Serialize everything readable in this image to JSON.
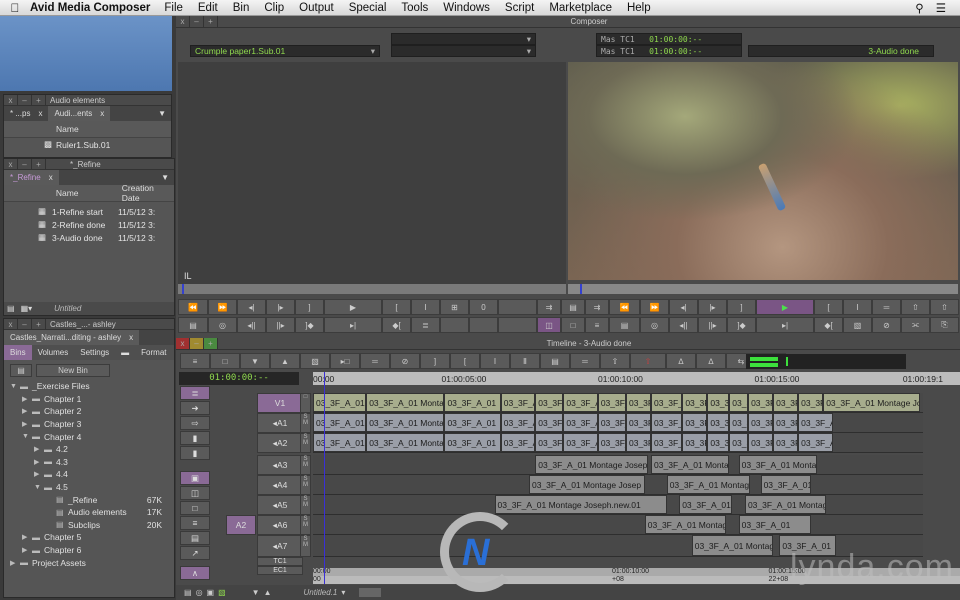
{
  "menubar": {
    "app": "Avid Media Composer",
    "items": [
      "File",
      "Edit",
      "Bin",
      "Clip",
      "Output",
      "Special",
      "Tools",
      "Windows",
      "Script",
      "Marketplace",
      "Help"
    ]
  },
  "audio_bin": {
    "title": "Audio elements",
    "tabs": [
      "* ...ps",
      "Audi...ents"
    ],
    "col_name": "Name",
    "rows": [
      "Ruler1.Sub.01"
    ]
  },
  "refine_bin": {
    "title": "*_Refine",
    "tab": "*_Refine",
    "col_name": "Name",
    "col_date": "Creation Date",
    "rows": [
      {
        "name": "1-Refine start",
        "date": "11/5/12 3:"
      },
      {
        "name": "2-Refine done",
        "date": "11/5/12 3:"
      },
      {
        "name": "3-Audio done",
        "date": "11/5/12 3:"
      }
    ],
    "footer": "Untitled"
  },
  "project": {
    "title": "Castles_...- ashley",
    "tab": "Castles_Narrati...diting - ashley",
    "subtabs": [
      "Bins",
      "Volumes",
      "Settings",
      "Format"
    ],
    "new_bin": "New Bin",
    "tree": [
      {
        "label": "_Exercise Files",
        "level": 0,
        "state": "open"
      },
      {
        "label": "Chapter 1",
        "level": 1,
        "state": "closed"
      },
      {
        "label": "Chapter 2",
        "level": 1,
        "state": "closed"
      },
      {
        "label": "Chapter 3",
        "level": 1,
        "state": "closed"
      },
      {
        "label": "Chapter 4",
        "level": 1,
        "state": "open"
      },
      {
        "label": "4.2",
        "level": 2,
        "state": "closed"
      },
      {
        "label": "4.3",
        "level": 2,
        "state": "closed"
      },
      {
        "label": "4.4",
        "level": 2,
        "state": "closed"
      },
      {
        "label": "4.5",
        "level": 2,
        "state": "open"
      },
      {
        "label": "_Refine",
        "level": 3,
        "state": "bin",
        "size": "67K"
      },
      {
        "label": "Audio elements",
        "level": 3,
        "state": "bin",
        "size": "17K"
      },
      {
        "label": "Subclips",
        "level": 3,
        "state": "bin",
        "size": "20K"
      },
      {
        "label": "Chapter 5",
        "level": 1,
        "state": "closed"
      },
      {
        "label": "Chapter 6",
        "level": 1,
        "state": "closed"
      },
      {
        "label": "Project Assets",
        "level": 0,
        "state": "closed"
      }
    ]
  },
  "composer": {
    "title": "Composer",
    "source_clip": "Crumple paper1.Sub.01",
    "record_seq": "3-Audio done",
    "tc_rows": [
      {
        "label": "Mas TC1",
        "value": "01:00:00:--"
      },
      {
        "label": "Mas TC1",
        "value": "01:00:00:--"
      }
    ],
    "source_mark": "IL"
  },
  "timeline": {
    "title": "Timeline - 3-Audio done",
    "timecode": "01:00:00:--",
    "ruler": [
      "00:00",
      "01:00:05:00",
      "01:00:10:00",
      "01:00:15:00",
      "01:00:19:1"
    ],
    "tc1": [
      "00:00",
      "01:00:10:00",
      "01:00:15:00"
    ],
    "ec1": [
      "00",
      "+08",
      "22+08"
    ],
    "tracks": [
      "V1",
      "A1",
      "A2",
      "A3",
      "A4",
      "A5",
      "A6",
      "A7"
    ],
    "source_track": "A2",
    "aux_tracks": [
      "TC1",
      "EC1"
    ],
    "footer_seq": "Untitled.1",
    "clips": {
      "V1": [
        [
          0,
          1.7,
          "03_3F_A_01"
        ],
        [
          1.7,
          4.2,
          "03_3F_A_01 Montage"
        ],
        [
          4.2,
          6.0,
          "03_3F_A_01"
        ],
        [
          6.0,
          7.1,
          "03_3F_A_01"
        ],
        [
          7.1,
          8.0,
          "03_3F_A_01"
        ],
        [
          8.0,
          9.1,
          "03_3F_A_01"
        ],
        [
          9.1,
          10.0,
          "03_3F_A_01"
        ],
        [
          10.0,
          10.8,
          "03_3F_A_01"
        ],
        [
          10.8,
          11.8,
          "03_3F_A_01"
        ],
        [
          11.8,
          12.6,
          "03_3F_A_01"
        ],
        [
          12.6,
          13.3,
          "03_3F_A_01"
        ],
        [
          13.3,
          13.9,
          "03_3F_A_01"
        ],
        [
          13.9,
          14.7,
          "03_3F_A_01"
        ],
        [
          14.7,
          15.5,
          "03_3F_A_01"
        ],
        [
          15.5,
          16.3,
          "03_3F_A_01"
        ],
        [
          16.3,
          19.4,
          "03_3F_A_01 Montage Joseph"
        ]
      ],
      "A1": [
        [
          0,
          1.7,
          "03_3F_A_01"
        ],
        [
          1.7,
          4.2,
          "03_3F_A_01 Montage"
        ],
        [
          4.2,
          6.0,
          "03_3F_A_01"
        ],
        [
          6.0,
          7.1,
          "03_3F_A_01"
        ],
        [
          7.1,
          8.0,
          "03_3F_A_01"
        ],
        [
          8.0,
          9.1,
          "03_3F_A_01"
        ],
        [
          9.1,
          10.0,
          "03_3F_A_01"
        ],
        [
          10.0,
          10.8,
          "03_3F_A_01"
        ],
        [
          10.8,
          11.8,
          "03_3F_A_01"
        ],
        [
          11.8,
          12.6,
          "03_3F_A_01"
        ],
        [
          12.6,
          13.3,
          "03_3F_A_01"
        ],
        [
          13.3,
          13.9,
          "03_3F_A_01"
        ],
        [
          13.9,
          14.7,
          "03_3F_A_01"
        ],
        [
          14.7,
          15.5,
          "03_3F_A_01"
        ],
        [
          15.5,
          16.6,
          "03_3F_A_01"
        ]
      ],
      "A2": [
        [
          0,
          1.7,
          "03_3F_A_01"
        ],
        [
          1.7,
          4.2,
          "03_3F_A_01 Montage"
        ],
        [
          4.2,
          6.0,
          "03_3F_A_01"
        ],
        [
          6.0,
          7.1,
          "03_3F_A_01"
        ],
        [
          7.1,
          8.0,
          "03_3F_A_01"
        ],
        [
          8.0,
          9.1,
          "03_3F_A_01"
        ],
        [
          9.1,
          10.0,
          "03_3F_A_01"
        ],
        [
          10.0,
          10.8,
          "03_3F_A_01"
        ],
        [
          10.8,
          11.8,
          "03_3F_A_01"
        ],
        [
          11.8,
          12.6,
          "03_3F_A_01"
        ],
        [
          12.6,
          13.3,
          "03_3F_A_01"
        ],
        [
          13.3,
          13.9,
          "03_3F_A_01"
        ],
        [
          13.9,
          14.7,
          "03_3F_A_01"
        ],
        [
          14.7,
          15.5,
          "03_3F_A_01"
        ],
        [
          15.5,
          16.6,
          "03_3F_A_01"
        ]
      ],
      "A3": [
        [
          7.1,
          10.7,
          "03_3F_A_01 Montage Joseph"
        ],
        [
          10.8,
          13.3,
          "03_3F_A_01 Montage"
        ],
        [
          13.6,
          16.1,
          "03_3F_A_01 Montage"
        ]
      ],
      "A4": [
        [
          6.9,
          10.6,
          "03_3F_A_01 Montage Josep"
        ],
        [
          11.3,
          13.96,
          "03_3F_A_01 Montage"
        ],
        [
          14.3,
          15.9,
          "03_3F_A_01"
        ]
      ],
      "A5": [
        [
          5.8,
          11.3,
          "03_3F_A_01 Montage Joseph.new.01"
        ],
        [
          11.7,
          13.4,
          "03_3F_A_01"
        ],
        [
          13.8,
          16.4,
          "03_3F_A_01 Montage"
        ]
      ],
      "A6": [
        [
          10.6,
          13.2,
          "03_3F_A_01 Montage"
        ],
        [
          13.6,
          15.9,
          "03_3F_A_01"
        ]
      ],
      "A7": [
        [
          12.1,
          14.7,
          "03_3F_A_01 Montage"
        ],
        [
          14.9,
          16.7,
          "03_3F_A_01"
        ]
      ]
    }
  },
  "watermark": "lynda.com",
  "colors": {
    "accent": "#8a6a96",
    "timecode": "#8fd84e",
    "video_clip": "#a7ad8d",
    "audio_clip": "#9a9ea7"
  }
}
